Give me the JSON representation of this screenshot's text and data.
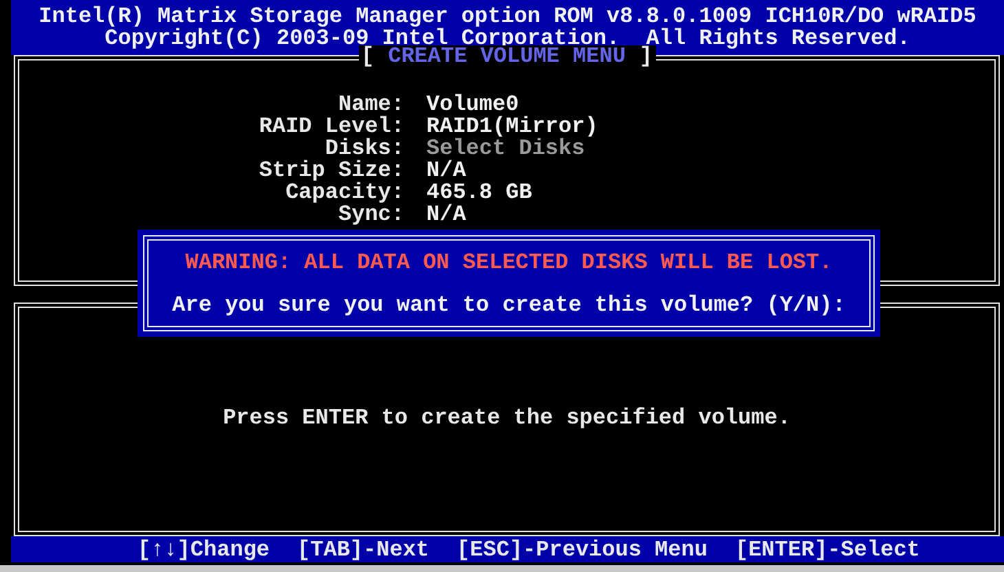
{
  "header": {
    "lines": [
      "Intel(R) Matrix Storage Manager option ROM v8.8.0.1009 ICH10R/DO wRAID5",
      "Copyright(C) 2003-09 Intel Corporation.  All Rights Reserved."
    ]
  },
  "menu": {
    "title_left": "[",
    "title": "CREATE VOLUME MENU",
    "title_right": "]",
    "fields": [
      {
        "label": "Name:",
        "value": "Volume0",
        "dimmed": false
      },
      {
        "label": "RAID Level:",
        "value": "RAID1(Mirror)",
        "dimmed": false
      },
      {
        "label": "Disks:",
        "value": "Select Disks",
        "dimmed": true
      },
      {
        "label": "Strip Size:",
        "value": "N/A",
        "dimmed": false
      },
      {
        "label": "Capacity:",
        "value": "465.8 GB",
        "dimmed": false
      },
      {
        "label": "Sync:",
        "value": "N/A",
        "dimmed": false
      }
    ]
  },
  "dialog": {
    "warning": "WARNING: ALL DATA ON SELECTED DISKS WILL BE LOST.",
    "question": "Are you sure you want to create this volume? (Y/N):"
  },
  "help": {
    "text": "Press ENTER to create the specified volume."
  },
  "footer": {
    "keys": [
      "[↑↓]Change",
      "[TAB]-Next",
      "[ESC]-Previous Menu",
      "[ENTER]-Select"
    ]
  }
}
